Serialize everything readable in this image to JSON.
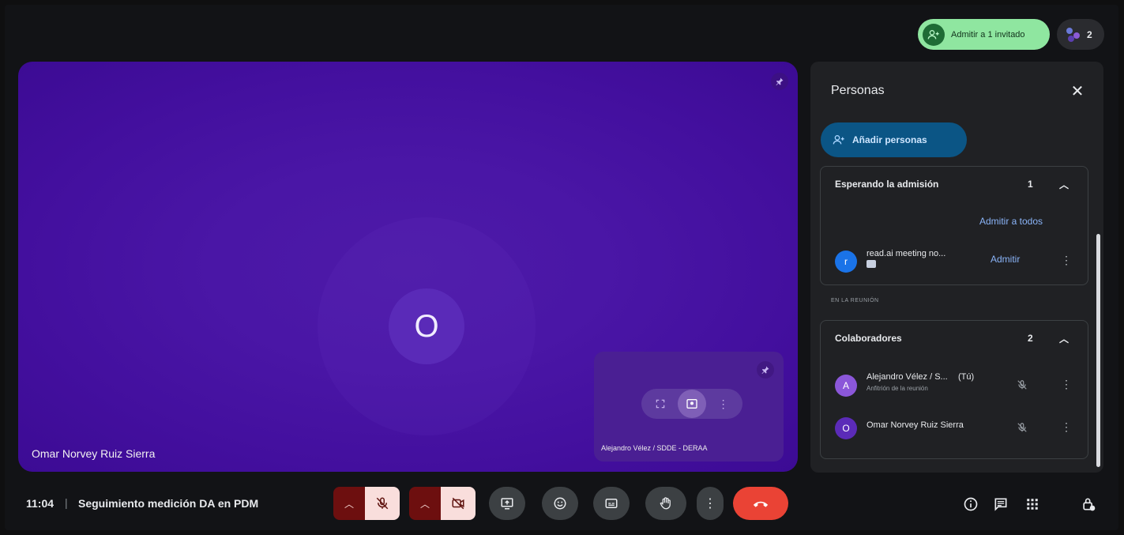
{
  "header": {
    "admit_pill_label": "Admitir a 1 invitado",
    "participants_count": "2"
  },
  "main_tile": {
    "avatar_initial": "O",
    "participant_name": "Omar Norvey Ruiz Sierra"
  },
  "self_tile": {
    "participant_name": "Alejandro Vélez / SDDE - DERAA"
  },
  "people_panel": {
    "title": "Personas",
    "close_icon": "close-icon",
    "add_button_label": "Añadir personas",
    "waiting": {
      "label": "Esperando la admisión",
      "count": "1",
      "admit_all_label": "Admitir a todos",
      "guest": {
        "initial": "r",
        "name": "read.ai meeting no...",
        "admit_label": "Admitir"
      }
    },
    "in_meeting_label": "EN LA REUNIÓN",
    "collaborators": {
      "label": "Colaboradores",
      "count": "2",
      "members": [
        {
          "initial": "A",
          "name": "Alejandro Vélez / S...",
          "tag": "(Tú)",
          "role": "Anfitrión de la reunión"
        },
        {
          "initial": "O",
          "name": "Omar Norvey Ruiz Sierra",
          "tag": "",
          "role": ""
        }
      ]
    }
  },
  "bottom_bar": {
    "time": "11:04",
    "separator": "|",
    "meeting_title": "Seguimiento medición DA en PDM"
  },
  "colors": {
    "tile_purple": "#4a16a6",
    "accent_blue": "#8ab4f8",
    "hangup_red": "#ea4335",
    "admit_green": "#8fe6a0"
  }
}
